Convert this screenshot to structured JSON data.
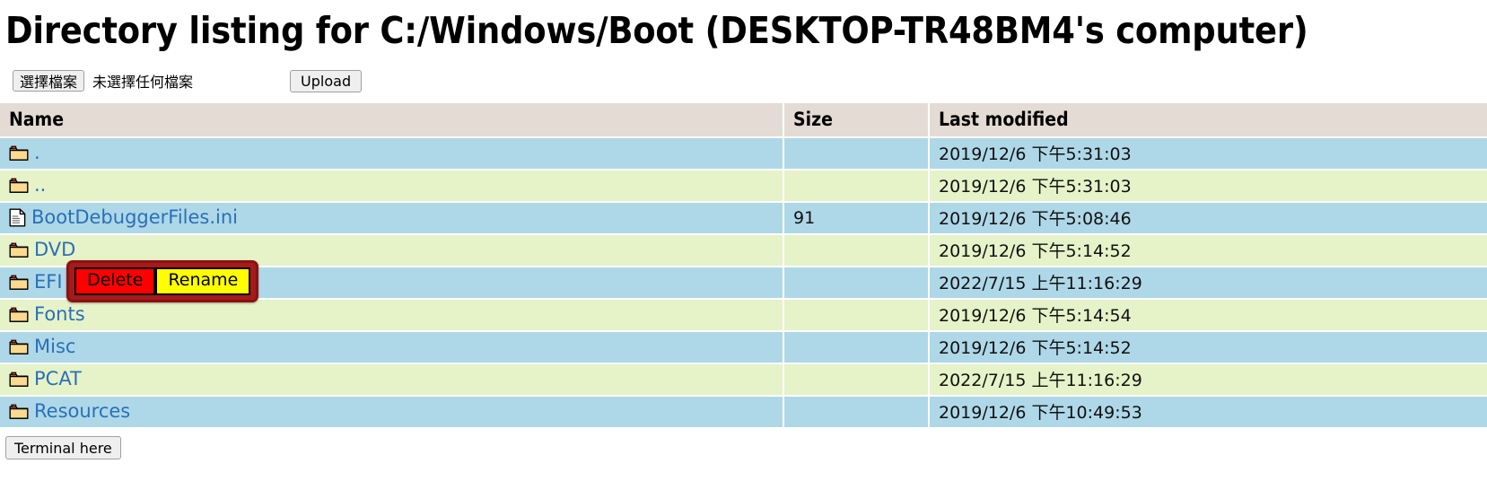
{
  "page": {
    "title": "Directory listing for C:/Windows/Boot (DESKTOP-TR48BM4's computer)",
    "path": "C:/Windows/Boot",
    "computer_name": "DESKTOP-TR48BM4"
  },
  "toolbar": {
    "choose_file_label": "選擇檔案",
    "no_file_selected_label": "未選擇任何檔案",
    "upload_label": "Upload"
  },
  "table": {
    "headers": {
      "name": "Name",
      "size": "Size",
      "last_modified": "Last modified"
    },
    "rows": [
      {
        "name": ".",
        "icon": "folder-icon",
        "size": "",
        "modified": "2019/12/6 下午5:31:03"
      },
      {
        "name": "..",
        "icon": "folder-icon",
        "size": "",
        "modified": "2019/12/6 下午5:31:03"
      },
      {
        "name": "BootDebuggerFiles.ini",
        "icon": "file-icon",
        "size": "91",
        "modified": "2019/12/6 下午5:08:46"
      },
      {
        "name": "DVD",
        "icon": "folder-icon",
        "size": "",
        "modified": "2019/12/6 下午5:14:52"
      },
      {
        "name": "EFI",
        "icon": "folder-icon",
        "size": "",
        "modified": "2022/7/15 上午11:16:29"
      },
      {
        "name": "Fonts",
        "icon": "folder-icon",
        "size": "",
        "modified": "2019/12/6 下午5:14:54"
      },
      {
        "name": "Misc",
        "icon": "folder-icon",
        "size": "",
        "modified": "2019/12/6 下午5:14:52"
      },
      {
        "name": "PCAT",
        "icon": "folder-icon",
        "size": "",
        "modified": "2022/7/15 上午11:16:29"
      },
      {
        "name": "Resources",
        "icon": "folder-icon",
        "size": "",
        "modified": "2019/12/6 下午10:49:53"
      }
    ]
  },
  "context_menu": {
    "delete_label": "Delete",
    "rename_label": "Rename",
    "target_row_index": 4
  },
  "footer": {
    "terminal_label": "Terminal here"
  },
  "colors": {
    "header_bg": "#e4dcd4",
    "row_odd_bg": "#aed8e8",
    "row_even_bg": "#e6f2c8",
    "link": "#2a70b8",
    "popup_border": "#8c1111",
    "popup_bg": "#a51a1a",
    "delete_bg": "#ff0000",
    "rename_bg": "#ffff00",
    "folder_icon": "#f5c96a",
    "folder_tab": "#e8312b"
  }
}
